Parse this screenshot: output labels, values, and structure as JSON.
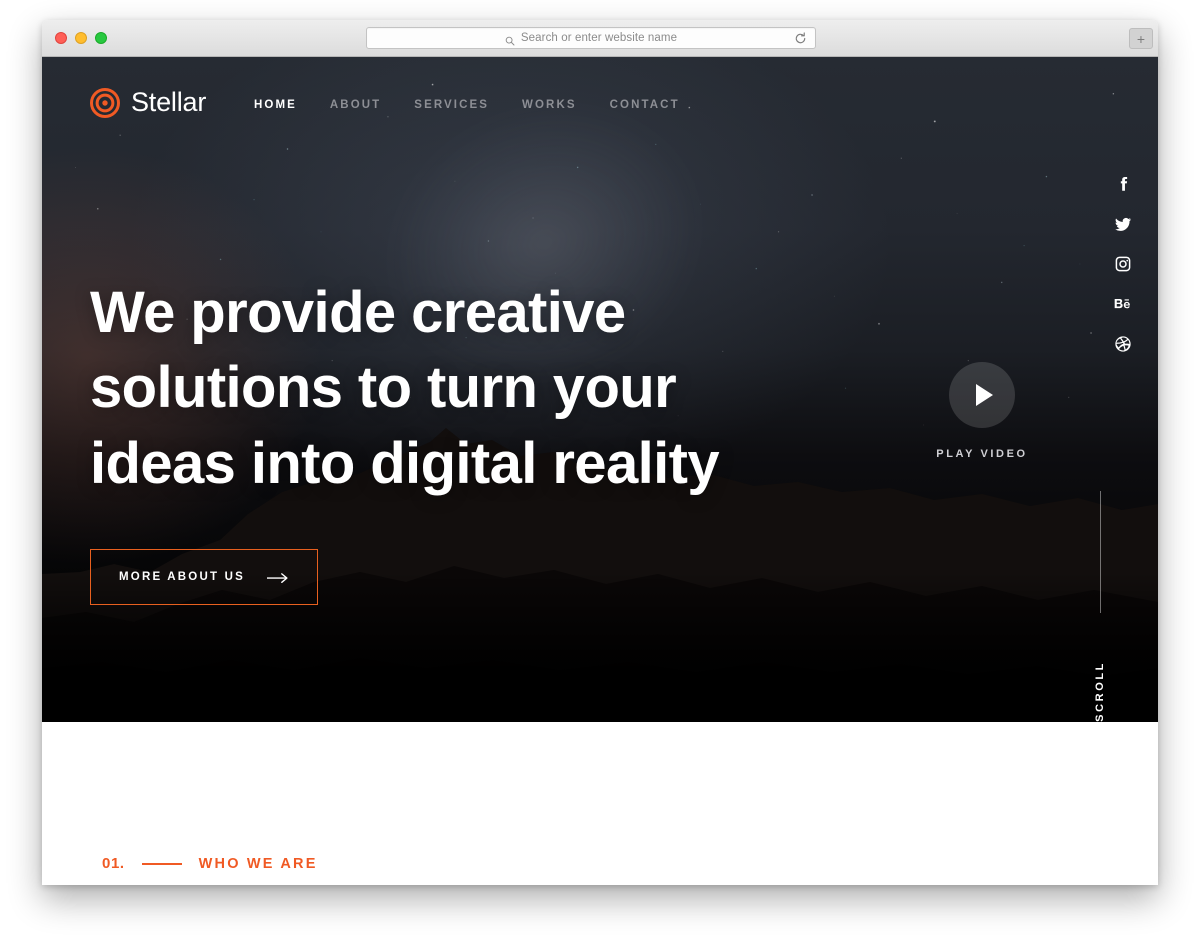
{
  "browser": {
    "traffic_lights": [
      "close",
      "minimize",
      "maximize"
    ],
    "address_placeholder": "Search or enter website name",
    "search_icon": "search-icon",
    "reload_icon": "reload-icon",
    "new_tab_label": "+"
  },
  "site": {
    "brand": {
      "name": "Stellar",
      "logo_icon": "concentric-circles-logo-icon",
      "color": "#f05a24"
    },
    "nav": [
      {
        "label": "HOME",
        "active": true
      },
      {
        "label": "ABOUT",
        "active": false
      },
      {
        "label": "SERVICES",
        "active": false
      },
      {
        "label": "WORKS",
        "active": false
      },
      {
        "label": "CONTACT",
        "active": false
      }
    ],
    "social": [
      {
        "name": "facebook-icon",
        "label": "Facebook"
      },
      {
        "name": "twitter-icon",
        "label": "Twitter"
      },
      {
        "name": "instagram-icon",
        "label": "Instagram"
      },
      {
        "name": "behance-icon",
        "label": "Behance"
      },
      {
        "name": "dribbble-icon",
        "label": "Dribbble"
      }
    ],
    "hero": {
      "heading_line1": "We provide creative",
      "heading_line2": "solutions to turn your",
      "heading_line3": "ideas into digital reality",
      "cta_label": "MORE ABOUT US",
      "cta_icon": "arrow-right-icon",
      "cta_border_color": "#e8601f",
      "play_label": "PLAY VIDEO",
      "play_icon": "play-triangle-icon",
      "scroll_label": "SCROLL"
    },
    "who_we_are": {
      "number": "01.",
      "title": "WHO WE ARE",
      "accent_color": "#f05a24"
    }
  }
}
